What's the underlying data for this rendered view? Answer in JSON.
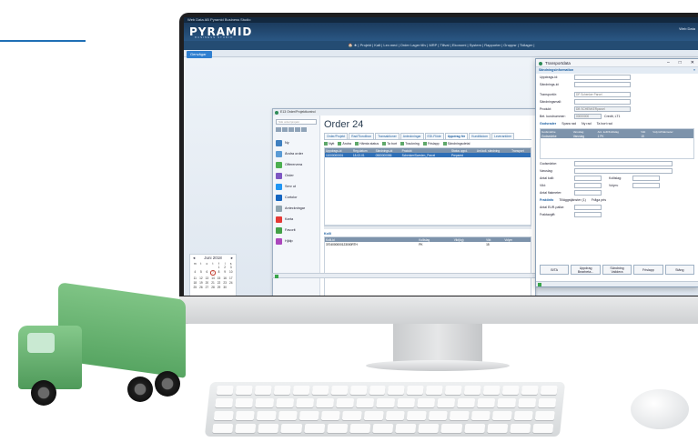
{
  "app": {
    "title_bar": "Web Data AB   Pyramid Business Studio",
    "logo": "PYRAMID",
    "logo_sub": "BUSINESS STUDIO",
    "user": "Web Data",
    "menu": "🏠 ★  | Projekt | Kalt | Lev.med | Order Lager tillv | MRP | Tillval | Ekonomi | System | Rapporter | Gruppsr | Tidlager |"
  },
  "start_button": "Genvägar",
  "calendar": {
    "month": "Juni 2018",
    "weekdays": [
      "m",
      "t",
      "o",
      "t",
      "f",
      "l",
      "s"
    ],
    "days": [
      "",
      "",
      "",
      "",
      "1",
      "2",
      "3",
      "4",
      "5",
      "6",
      "7",
      "8",
      "9",
      "10",
      "11",
      "12",
      "13",
      "14",
      "15",
      "16",
      "17",
      "18",
      "19",
      "20",
      "21",
      "22",
      "23",
      "24",
      "25",
      "26",
      "27",
      "28",
      "29",
      "30",
      ""
    ],
    "today": "7"
  },
  "order_window": {
    "title": "E13 Order/Projektkontrol",
    "search_placeholder": "Sök order/projekt",
    "heading": "Order 24",
    "tabs": [
      "Order/Projekt",
      "Rad/Tiorolibon",
      "Transaktioner",
      "Anteckningar",
      "EDI-Flöde",
      "Uppdrag för",
      "Kundtikdom",
      "Leverantörer"
    ],
    "active_tab": 5,
    "tools": [
      "Nytt",
      "Ändra",
      "Hämta status",
      "Ta bort",
      "Trackning",
      "Frislapp",
      "Sändningsdetal"
    ],
    "side": [
      "Ny",
      "Ändra order",
      "Offerervera",
      "Order",
      "Serv ut",
      "Cortolor",
      "Anteckningar",
      "Karta",
      "Favorit",
      "Hjälp"
    ],
    "grid_headers": [
      "Uppdrags-id",
      "Reg.datum",
      "Sändnings-id",
      "Produkt",
      "Status uppd.",
      "Ant.koll. sändning",
      "Transport"
    ],
    "grid_rows": [
      [
        "11000000001",
        "18-02-01",
        "0583000086",
        "Schenker/Sweden_Parcel",
        "Prepared",
        "",
        ""
      ]
    ],
    "kolli_label": "Kolli",
    "kolli_headers": [
      "Kolli-id",
      "Kollislag",
      "Vikt(kg)",
      "Vikt",
      "Volym"
    ],
    "kolli_rows": [
      [
        "3704000000123000RTH",
        "PK",
        "",
        "15",
        ""
      ]
    ]
  },
  "dialog": {
    "title": "Transportdata",
    "section1": "Sändningsinformation",
    "fields1": [
      {
        "label": "Uppdrags-id:",
        "value": ""
      },
      {
        "label": "Sändnings-id:",
        "value": ""
      }
    ],
    "fields2": [
      {
        "label": "Transportör:",
        "value": "DP Schenker Parcel"
      },
      {
        "label": "Sändningsmall:",
        "value": ""
      },
      {
        "label": "Produkt:",
        "value": "DB SCHENKERparcel"
      },
      {
        "label": "Bet. kundnummer:",
        "value": "00000000"
      }
    ],
    "credit_label": "Credit, LT1",
    "section2": "Godsrader",
    "section2_tools": [
      "Spara rad",
      "Ny rad",
      "Ta bort rad"
    ],
    "gods_headers": [
      "Godsmärke",
      "Varuslag",
      "Ant. kolli/Kollislag",
      "Vikt",
      "Volym/Flakmeter"
    ],
    "gods_rows": [
      [
        "Godsmärke",
        "Varuslag",
        "1 PK",
        "15",
        ""
      ]
    ],
    "fields3": [
      "Godsmärke:",
      "Varuslag:"
    ],
    "antal_kolli": "Antal kolli:",
    "kollislag": "Kollislag:",
    "vikt": "Vikt:",
    "volym": "Volym:",
    "flakmeter": "Antal flakmeter:",
    "section3": "Fraktinfo",
    "section3_tools": [
      "Tilläggstjänster (1)",
      "Fråga pris"
    ],
    "eur_pallar": "Antal EUR-pallar:",
    "fraktavgift": "Fraktavgift:",
    "buttons": [
      {
        "top": "",
        "label": "B/TA"
      },
      {
        "top": "Uppdrag",
        "label": "Bearbeta..."
      },
      {
        "top": "Sändning",
        "label": "Validera"
      },
      {
        "top": "",
        "label": "Frislapp"
      },
      {
        "top": "",
        "label": "Stäng"
      }
    ]
  }
}
